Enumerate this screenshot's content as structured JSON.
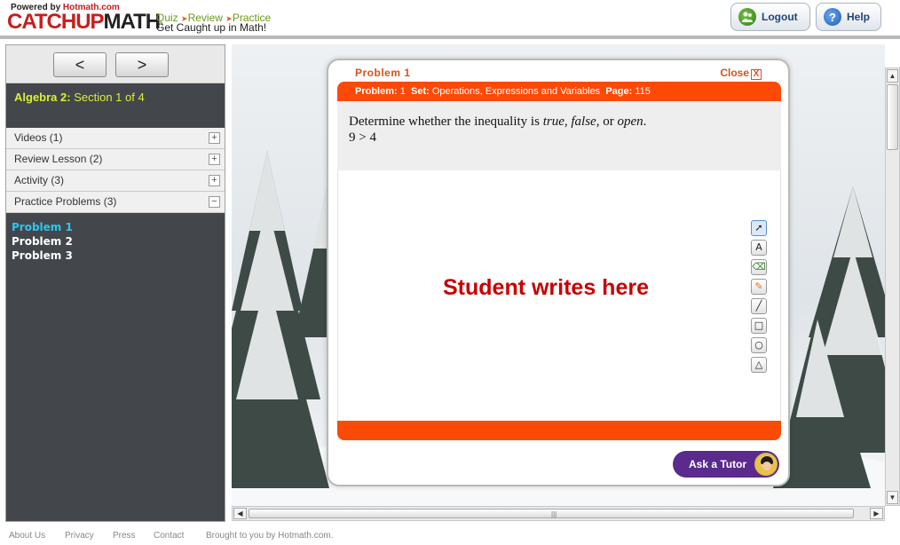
{
  "header": {
    "powered_prefix": "Powered by ",
    "powered_brand": "Hotmath.com",
    "logo_catchup": "CATCHUP",
    "logo_math": "MATH",
    "tagline_steps": [
      "Quiz",
      "Review",
      "Practice"
    ],
    "tagline": "Get Caught up in Math!",
    "logout_label": "Logout",
    "help_label": "Help",
    "help_icon_glyph": "?"
  },
  "sidebar": {
    "prev_label": "<",
    "next_label": ">",
    "course": "Algebra 2:",
    "section": "Section 1 of 4",
    "accordion": [
      {
        "label": "Videos (1)",
        "toggle": "+"
      },
      {
        "label": "Review Lesson (2)",
        "toggle": "+"
      },
      {
        "label": "Activity (3)",
        "toggle": "+"
      },
      {
        "label": "Practice Problems (3)",
        "toggle": "−"
      }
    ],
    "problems": [
      "Problem 1",
      "Problem 2",
      "Problem 3"
    ],
    "active_problem": "Problem 1"
  },
  "dialog": {
    "title": "Problem 1",
    "close_label": "Close",
    "close_glyph": "X",
    "info": {
      "problem_key": "Problem:",
      "problem_val": "1",
      "set_key": "Set:",
      "set_val": "Operations, Expressions and Variables",
      "page_key": "Page:",
      "page_val": "115"
    },
    "question": {
      "prefix": "Determine whether the inequality is ",
      "opt1": "true",
      "sep1": ", ",
      "opt2": "false",
      "sep2": ", or ",
      "opt3": "open",
      "suffix": ".",
      "expression": "9 > 4"
    },
    "workspace_text": "Student writes here",
    "tools": [
      {
        "name": "pointer-tool-icon",
        "glyph": "➚"
      },
      {
        "name": "text-tool-icon",
        "glyph": "A"
      },
      {
        "name": "eraser-tool-icon",
        "glyph": "⌫"
      },
      {
        "name": "pencil-tool-icon",
        "glyph": "✎"
      },
      {
        "name": "line-tool-icon",
        "glyph": "╱"
      },
      {
        "name": "rectangle-tool-icon",
        "glyph": "□"
      },
      {
        "name": "circle-tool-icon",
        "glyph": "○"
      },
      {
        "name": "triangle-tool-icon",
        "glyph": "△"
      }
    ],
    "ask_tutor_label": "Ask a Tutor"
  },
  "footer": {
    "links": [
      "About Us",
      "Privacy",
      "Press",
      "Contact"
    ],
    "credit": "Brought to you by Hotmath.com."
  },
  "colors": {
    "brand_red": "#c81e1e",
    "accent_orange": "#fb4a05",
    "sidebar_bg": "#43474b",
    "active_problem": "#27c8f0",
    "section_title": "#d8f03a",
    "tutor_purple": "#5a2a8c",
    "workspace_text": "#c80000"
  }
}
